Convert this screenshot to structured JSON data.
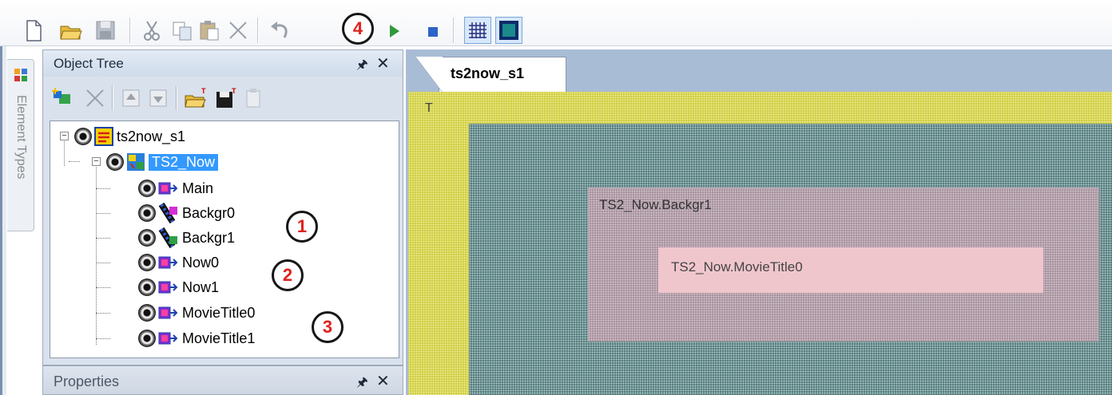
{
  "toolbar": {
    "badge": "4",
    "icons": [
      "new-file-icon",
      "open-folder-icon",
      "save-icon",
      "cut-icon",
      "copy-icon",
      "paste-icon",
      "delete-icon",
      "undo-icon",
      "play-icon",
      "stop-icon",
      "grid-icon",
      "frame-icon"
    ]
  },
  "side_tab": {
    "label": "Element Types"
  },
  "object_tree": {
    "title": "Object Tree",
    "nodes": [
      {
        "label": "ts2now_s1",
        "type": "scene"
      },
      {
        "label": "TS2_Now",
        "type": "template",
        "selected": true
      },
      {
        "label": "Main",
        "type": "container"
      },
      {
        "label": "Backgr0",
        "type": "movie"
      },
      {
        "label": "Backgr1",
        "type": "movie"
      },
      {
        "label": "Now0",
        "type": "container"
      },
      {
        "label": "Now1",
        "type": "container"
      },
      {
        "label": "MovieTitle0",
        "type": "container"
      },
      {
        "label": "MovieTitle1",
        "type": "container"
      }
    ],
    "badges": [
      "1",
      "2",
      "3"
    ]
  },
  "properties": {
    "title": "Properties"
  },
  "editor": {
    "tab": "ts2now_s1",
    "corner_label": "T",
    "backgr_label": "TS2_Now.Backgr1",
    "title_label": "TS2_Now.MovieTitle0"
  },
  "colors": {
    "canvas_yellow": "#c9c638",
    "canvas_teal": "#3f6b6c",
    "selection": "#3399ff",
    "badge_red": "#e0211d"
  }
}
